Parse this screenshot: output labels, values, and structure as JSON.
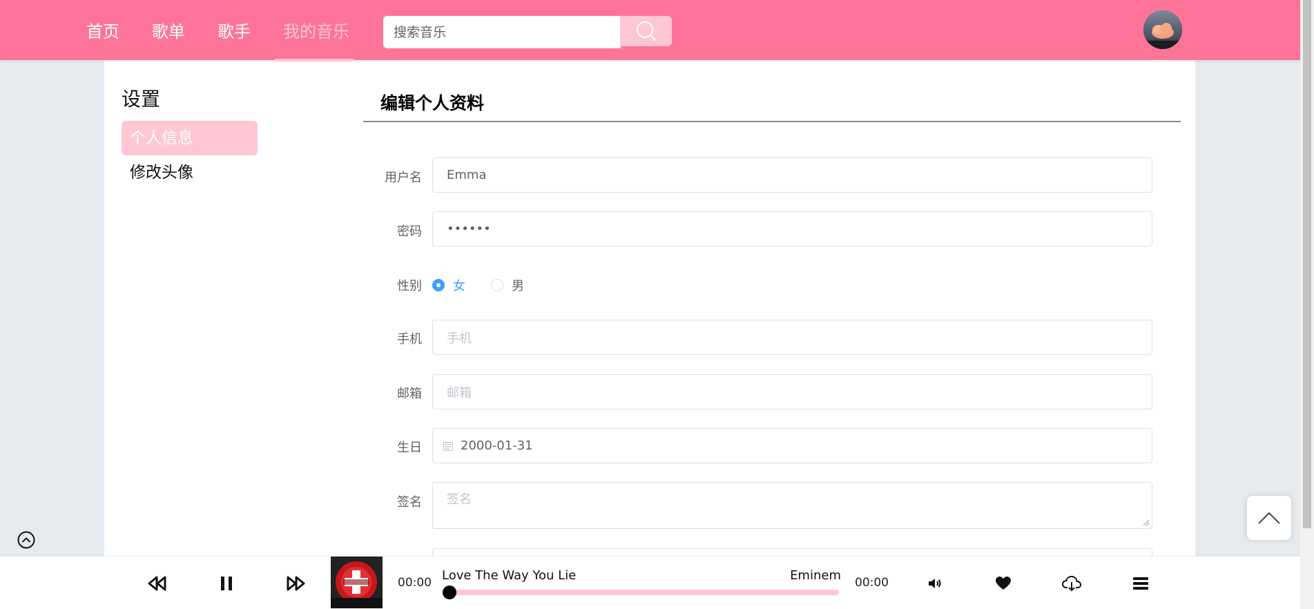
{
  "header": {
    "nav": [
      "首页",
      "歌单",
      "歌手",
      "我的音乐"
    ],
    "active_nav": "我的音乐",
    "search_placeholder": "搜索音乐"
  },
  "sidebar": {
    "title": "设置",
    "items": [
      {
        "label": "个人信息",
        "active": true
      },
      {
        "label": "修改头像",
        "active": false
      }
    ]
  },
  "form": {
    "title": "编辑个人资料",
    "username": {
      "label": "用户名",
      "value": "Emma"
    },
    "password": {
      "label": "密码",
      "value": "••••••"
    },
    "gender": {
      "label": "性别",
      "options": [
        "女",
        "男"
      ],
      "selected": "女"
    },
    "phone": {
      "label": "手机",
      "placeholder": "手机"
    },
    "email": {
      "label": "邮箱",
      "placeholder": "邮箱"
    },
    "birthday": {
      "label": "生日",
      "value": "2000-01-31"
    },
    "signature": {
      "label": "签名",
      "placeholder": "签名"
    }
  },
  "player": {
    "current_time": "00:00",
    "duration": "00:00",
    "song_title": "Love The Way You Lie",
    "artist": "Eminem",
    "progress": 0
  },
  "colors": {
    "brand": "#fe7499",
    "accent_light": "#ffc6d4",
    "radio_checked": "#409eff"
  }
}
